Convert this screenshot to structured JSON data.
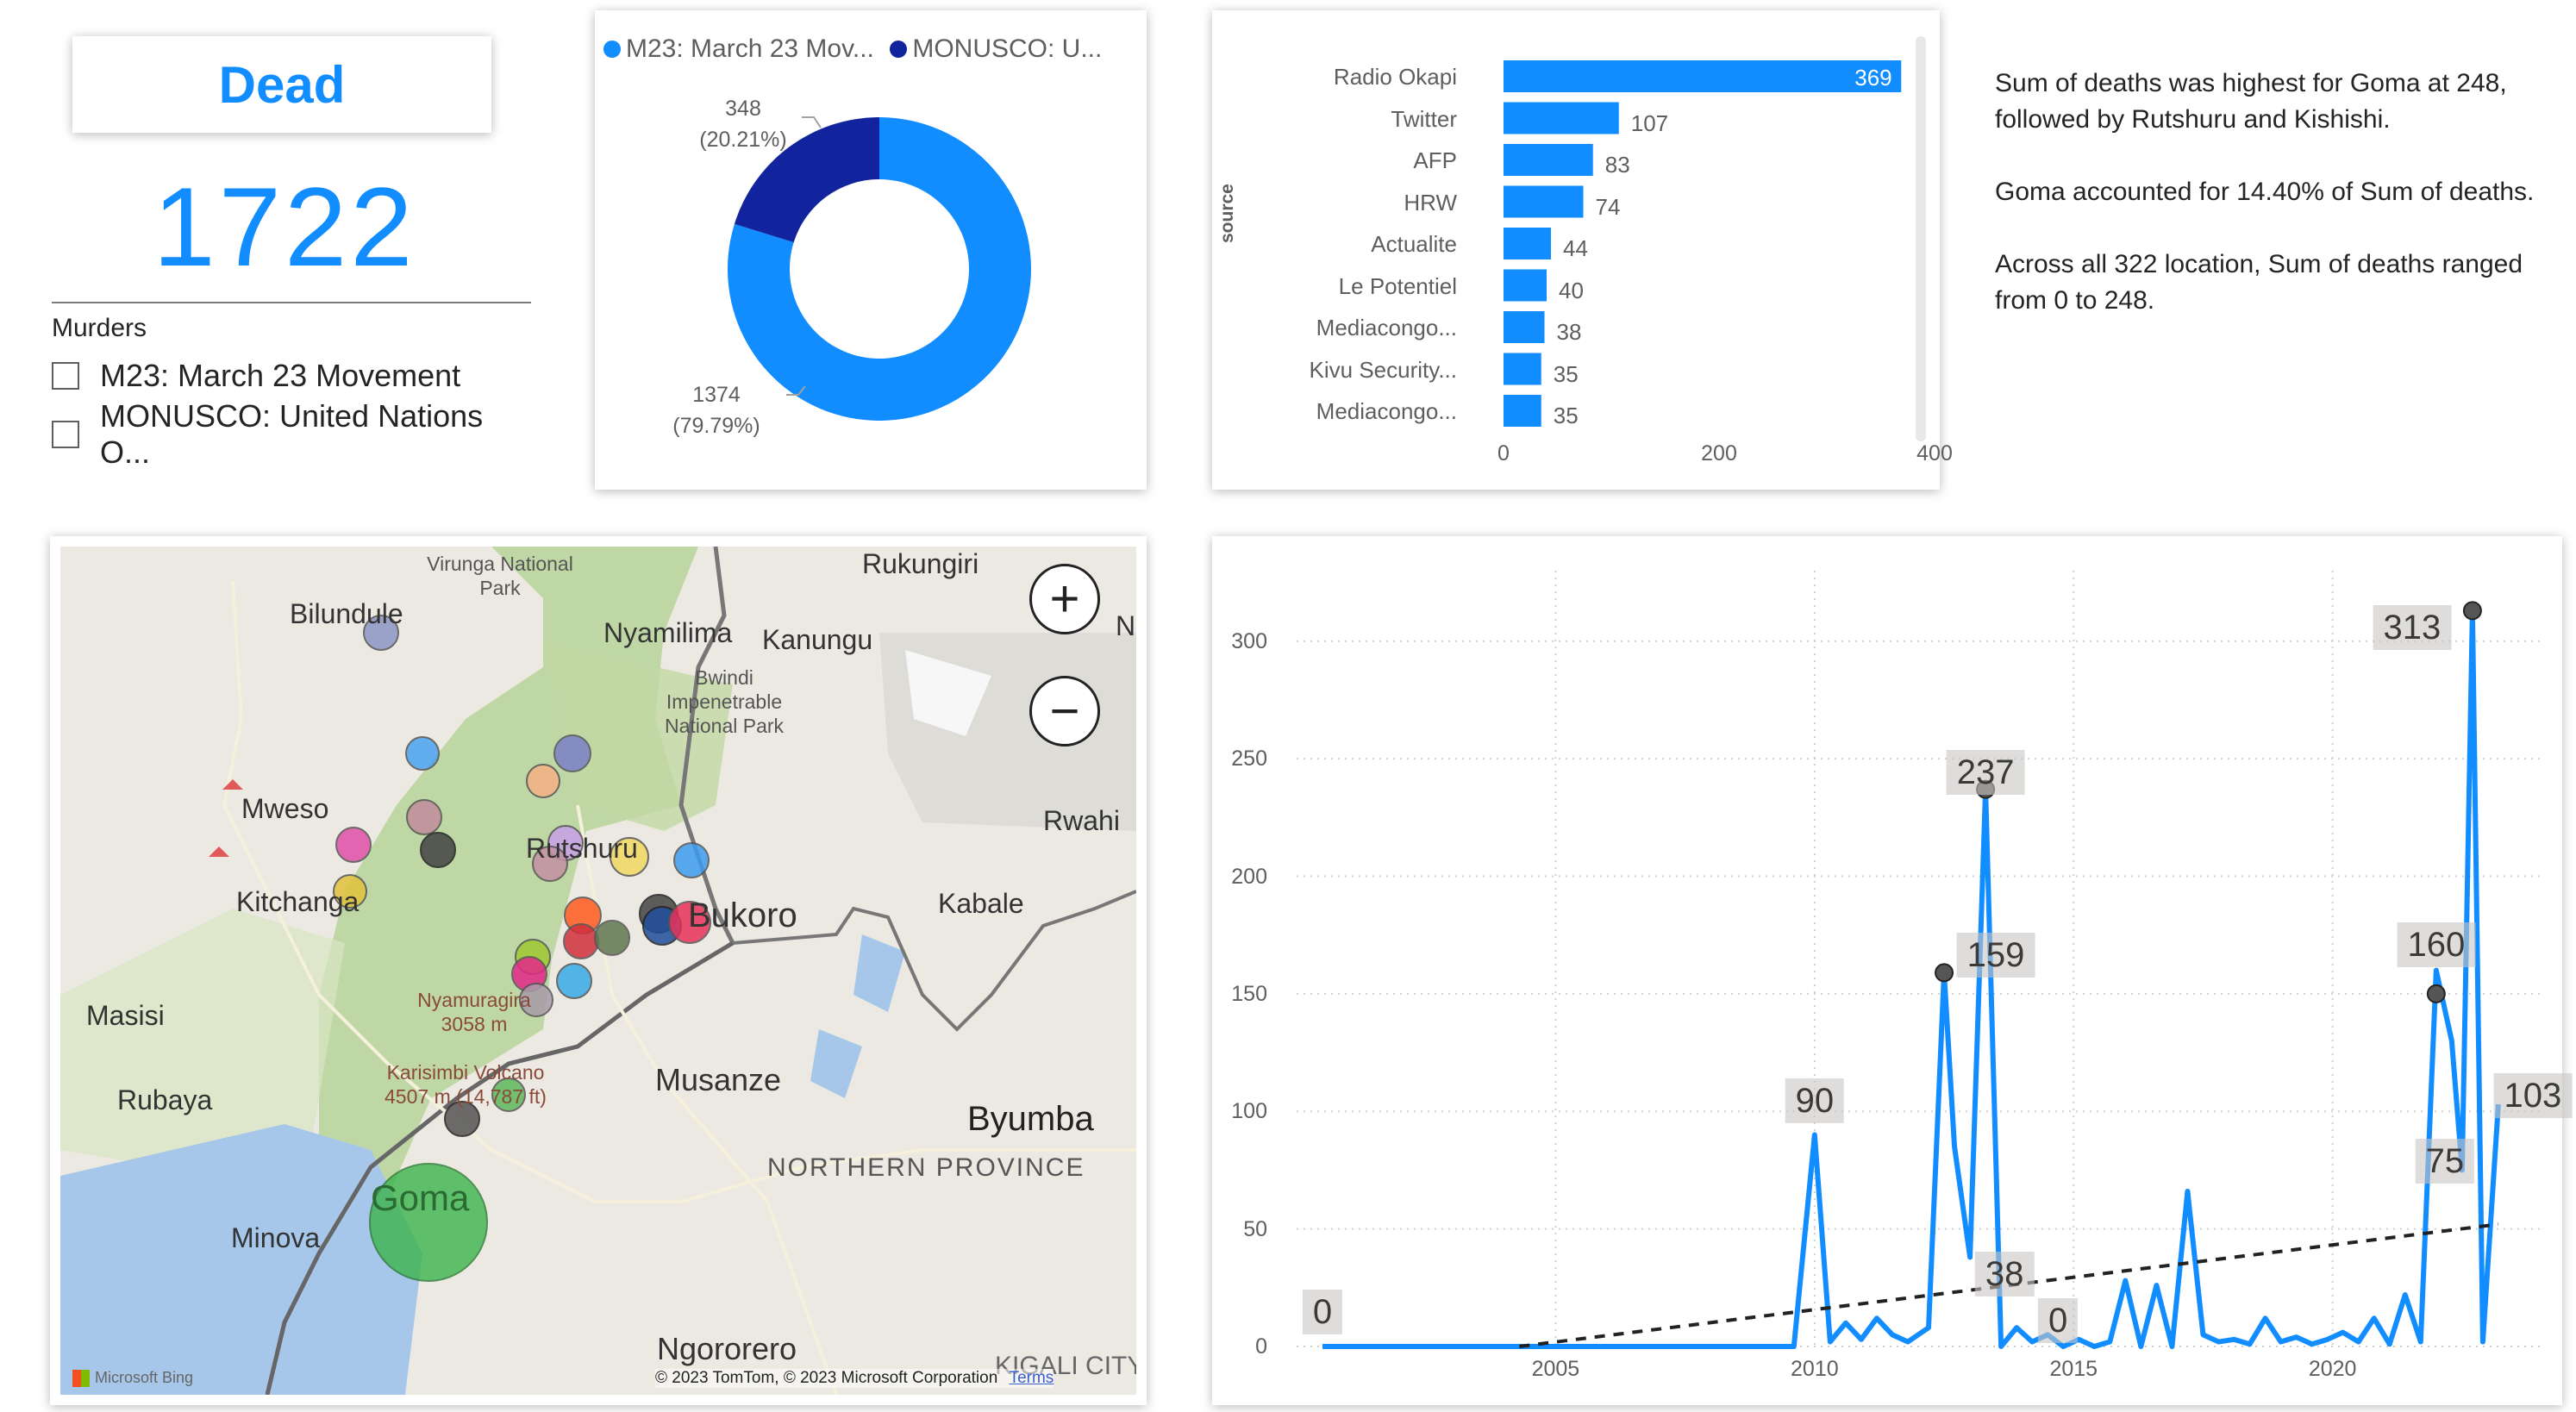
{
  "kpi": {
    "title": "Dead",
    "value": "1722"
  },
  "slicer": {
    "title": "Murders",
    "options": [
      "M23: March 23 Movement",
      "MONUSCO: United Nations O..."
    ]
  },
  "donut": {
    "legend": [
      {
        "label": "M23: March 23 Mov...",
        "color": "#118DFF"
      },
      {
        "label": "MONUSCO: U...",
        "color": "#12239E"
      }
    ],
    "labels": {
      "m23_value": "1374",
      "m23_pct": "(79.79%)",
      "monusco_value": "348",
      "monusco_pct": "(20.21%)"
    }
  },
  "chart_data": [
    {
      "type": "pie",
      "categories": [
        "M23: March 23 Movement",
        "MONUSCO: United Nations O..."
      ],
      "values": [
        1374,
        348
      ],
      "percentages": [
        "79.79%",
        "20.21%"
      ],
      "colors": [
        "#118DFF",
        "#12239E"
      ],
      "donut": true
    },
    {
      "type": "bar",
      "orientation": "horizontal",
      "ylabel": "source",
      "categories": [
        "Radio Okapi",
        "Twitter",
        "AFP",
        "HRW",
        "Actualite",
        "Le Potentiel",
        "Mediacongo...",
        "Kivu Security...",
        "Mediacongo..."
      ],
      "values": [
        369,
        107,
        83,
        74,
        44,
        40,
        38,
        35,
        35
      ],
      "xticks": [
        "0",
        "200",
        "400"
      ],
      "xlim": [
        0,
        400
      ],
      "color": "#118DFF"
    },
    {
      "type": "line",
      "x": [
        2000.5,
        2009.6,
        2010.0,
        2010.3,
        2010.6,
        2010.9,
        2011.2,
        2011.5,
        2011.8,
        2012.2,
        2012.5,
        2012.7,
        2013.0,
        2013.3,
        2013.6,
        2013.9,
        2014.2,
        2014.5,
        2014.8,
        2015.1,
        2015.4,
        2015.7,
        2016.0,
        2016.3,
        2016.6,
        2016.9,
        2017.2,
        2017.5,
        2017.8,
        2018.1,
        2018.4,
        2018.7,
        2019.0,
        2019.3,
        2019.6,
        2019.9,
        2020.2,
        2020.5,
        2020.8,
        2021.1,
        2021.4,
        2021.7,
        2022.0,
        2022.3,
        2022.5,
        2022.7,
        2022.9,
        2023.2
      ],
      "y": [
        0,
        0,
        90,
        2,
        10,
        3,
        12,
        5,
        2,
        8,
        159,
        85,
        38,
        237,
        0,
        8,
        2,
        5,
        0,
        3,
        0,
        2,
        28,
        0,
        26,
        0,
        66,
        5,
        2,
        3,
        1,
        12,
        2,
        4,
        1,
        3,
        6,
        2,
        12,
        1,
        22,
        2,
        160,
        130,
        75,
        313,
        2,
        103
      ],
      "trendline": {
        "x": [
          2004.3,
          2023.2
        ],
        "y": [
          0,
          52
        ]
      },
      "data_labels": [
        {
          "x": 2000.5,
          "y": 0,
          "text": "0"
        },
        {
          "x": 2010.0,
          "y": 90,
          "text": "90"
        },
        {
          "x": 2012.5,
          "y": 159,
          "text": "159"
        },
        {
          "x": 2013.3,
          "y": 237,
          "text": "237"
        },
        {
          "x": 2013.0,
          "y": 38,
          "text": "38"
        },
        {
          "x": 2014.2,
          "y": 0,
          "text": "0"
        },
        {
          "x": 2022.0,
          "y": 160,
          "text": "160"
        },
        {
          "x": 2022.7,
          "y": 313,
          "text": "313"
        },
        {
          "x": 2023.2,
          "y": 103,
          "text": "103"
        },
        {
          "x": 2022.5,
          "y": 75,
          "text": "75"
        }
      ],
      "yticks": [
        0,
        50,
        100,
        150,
        200,
        250,
        300
      ],
      "xticks": [
        2005,
        2010,
        2015,
        2020
      ],
      "ylim": [
        0,
        330
      ],
      "xlim": [
        2000,
        2024
      ],
      "color": "#118DFF"
    }
  ],
  "narrative": {
    "p1": "Sum of deaths was highest for Goma at 248, followed by Rutshuru and Kishishi.",
    "p2": "Goma accounted for 14.40% of Sum of deaths.",
    "p3": "Across all 322 location, Sum of deaths ranged from 0 to 248."
  },
  "map": {
    "places": [
      "Rukungiri",
      "Virunga National Park",
      "Bilundule",
      "Nyamilima",
      "Kanungu",
      "Bwindi Impenetrable National Park",
      "Mweso",
      "Rwahi",
      "Rutshuru",
      "Kitchanga",
      "Bukoro",
      "Kabale",
      "Masisi",
      "Nyamuragira 3058 m",
      "Karisimbi Volcano 4507 m (14,787 ft)",
      "Musanze",
      "Rubaya",
      "Byumba",
      "NORTHERN PROVINCE",
      "Goma",
      "Minova",
      "Ngororero",
      "KIGALI CITY",
      "N"
    ],
    "attribution": "© 2023 TomTom, © 2023 Microsoft Corporation",
    "terms": "Terms",
    "bing": "Microsoft Bing",
    "zoom_in": "+",
    "zoom_out": "−"
  }
}
